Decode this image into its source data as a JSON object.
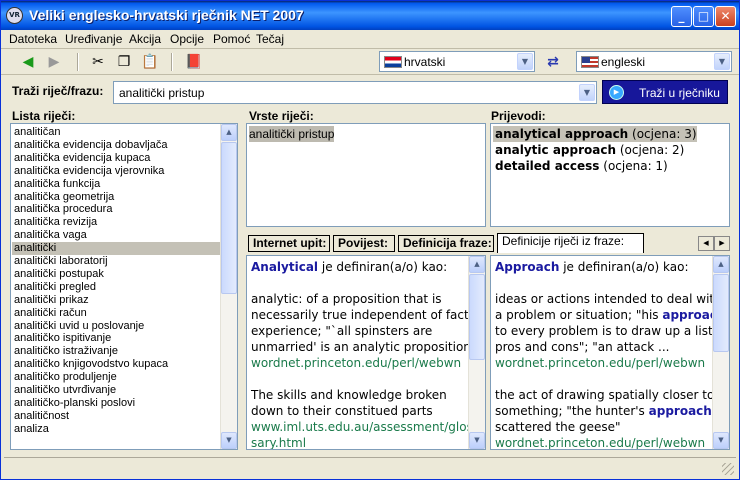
{
  "window": {
    "title": "Veliki englesko-hrvatski rječnik NET 2007",
    "icon_text": "VR"
  },
  "menu": [
    "Datoteka",
    "Uređivanje",
    "Akcija",
    "Opcije",
    "Pomoć",
    "Tečaj"
  ],
  "lang": {
    "source": "hrvatski",
    "target": "engleski"
  },
  "search": {
    "label": "Traži riječ/frazu:",
    "value": "analitički pristup",
    "button": "Traži u rječniku"
  },
  "word_list": {
    "label": "Lista riječi:",
    "selected_index": 10,
    "items": [
      "analitičan",
      "analitička evidencija dobavljača",
      "analitička evidencija kupaca",
      "analitička evidencija vjerovnika",
      "analitička funkcija",
      "analitička geometrija",
      "analitička procedura",
      "analitička revizija",
      "analitička vaga",
      "analitički",
      "analitički laboratorij",
      "analitički postupak",
      "analitički pregled",
      "analitički prikaz",
      "analitički račun",
      "analitički uvid u poslovanje",
      "analitičko ispitivanje",
      "analitičko istraživanje",
      "analitičko knjigovodstvo kupaca",
      "analitičko produljenje",
      "analitičko utvrđivanje",
      "analitičko-planski poslovi",
      "analitičnost",
      "analiza"
    ]
  },
  "word_types": {
    "label": "Vrste riječi:",
    "items": [
      "analitički pristup"
    ]
  },
  "translations": {
    "label": "Prijevodi:",
    "items": [
      {
        "term": "analytical approach",
        "grade": "(ocjena: 3)"
      },
      {
        "term": "analytic approach",
        "grade": "(ocjena: 2)"
      },
      {
        "term": "detailed access",
        "grade": "(ocjena: 1)"
      }
    ]
  },
  "tabs": [
    "Internet upit:",
    "Povijest:",
    "Definicija fraze:",
    "Definicije riječi iz fraze:"
  ],
  "def_left": {
    "word": "Analytical",
    "intro": " je definiran(a/o) kao:",
    "lines": [
      {
        "t": "analytic: of a proposition that is",
        "c": "n"
      },
      {
        "t": "necessarily true independent of fact or",
        "c": "n"
      },
      {
        "t": "experience; \"`all spinsters are",
        "c": "n"
      },
      {
        "t": "unmarried' is an analytic proposition\"",
        "c": "n"
      },
      {
        "t": "wordnet.princeton.edu/perl/webwn",
        "c": "g"
      },
      {
        "t": "",
        "c": "n"
      },
      {
        "t": "The skills and knowledge broken",
        "c": "n"
      },
      {
        "t": "down to their constitued parts",
        "c": "n"
      },
      {
        "t": "www.iml.uts.edu.au/assessment/glos",
        "c": "g"
      },
      {
        "t": "sary.html",
        "c": "g"
      }
    ]
  },
  "def_right": {
    "word": "Approach",
    "intro": " je definiran(a/o) kao:",
    "lines": [
      {
        "p": [
          {
            "t": "ideas or actions intended to deal with",
            "c": "n"
          }
        ]
      },
      {
        "p": [
          {
            "t": "a problem or situation; \"his ",
            "c": "n"
          },
          {
            "t": "approach",
            "c": "b"
          }
        ]
      },
      {
        "p": [
          {
            "t": "to every problem is to draw up a list of",
            "c": "n"
          }
        ]
      },
      {
        "p": [
          {
            "t": "pros and cons\"; \"an attack ...",
            "c": "n"
          }
        ]
      },
      {
        "p": [
          {
            "t": "wordnet.princeton.edu/perl/webwn",
            "c": "g"
          }
        ]
      },
      {
        "p": []
      },
      {
        "p": [
          {
            "t": "the act of drawing spatially closer to",
            "c": "n"
          }
        ]
      },
      {
        "p": [
          {
            "t": "something; \"the hunter's ",
            "c": "n"
          },
          {
            "t": "approach",
            "c": "b"
          }
        ]
      },
      {
        "p": [
          {
            "t": "scattered the geese\"",
            "c": "n"
          }
        ]
      },
      {
        "p": [
          {
            "t": "wordnet.princeton.edu/perl/webwn",
            "c": "g"
          }
        ]
      }
    ]
  }
}
